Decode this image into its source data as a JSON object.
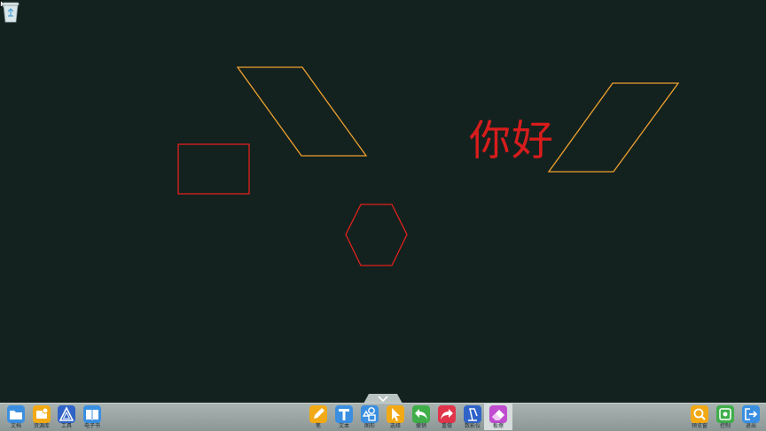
{
  "canvas": {
    "text": "你好",
    "text_color": "#d81c1c",
    "shape_colors": {
      "orange": "#f0a030",
      "red": "#e0201e"
    }
  },
  "toolbar": {
    "left": [
      {
        "id": "doc",
        "label": "文档",
        "icon": "folder-icon",
        "color": "#3a8fe0"
      },
      {
        "id": "resources",
        "label": "资源库",
        "icon": "resource-library-icon",
        "color": "#f2a916"
      },
      {
        "id": "tools",
        "label": "工具",
        "icon": "tools-triangle-icon",
        "color": "#2f63c8"
      },
      {
        "id": "ebook",
        "label": "电子书",
        "icon": "book-icon",
        "color": "#3a8fe0"
      }
    ],
    "center": [
      {
        "id": "pen",
        "label": "笔",
        "icon": "pen-icon",
        "color": "#f2a916"
      },
      {
        "id": "text",
        "label": "文本",
        "icon": "text-icon",
        "color": "#3a8fe0"
      },
      {
        "id": "shape",
        "label": "图形",
        "icon": "shapes-icon",
        "color": "#3a8fe0"
      },
      {
        "id": "select",
        "label": "选择",
        "icon": "select-cursor-icon",
        "color": "#f2a916"
      },
      {
        "id": "undo",
        "label": "撤销",
        "icon": "undo-icon",
        "color": "#3fae49"
      },
      {
        "id": "redo",
        "label": "重做",
        "icon": "redo-icon",
        "color": "#e0344a"
      },
      {
        "id": "camera",
        "label": "数影仪",
        "icon": "visualizer-icon",
        "color": "#2f63c8"
      },
      {
        "id": "eraser",
        "label": "板擦",
        "icon": "eraser-icon",
        "color": "#c04ccf"
      }
    ],
    "right": [
      {
        "id": "preview",
        "label": "预览窗",
        "icon": "preview-icon",
        "color": "#f2a916"
      },
      {
        "id": "control",
        "label": "控制",
        "icon": "control-icon",
        "color": "#3fae49"
      },
      {
        "id": "exit",
        "label": "退出",
        "icon": "exit-icon",
        "color": "#3a8fe0"
      }
    ],
    "active": "eraser"
  }
}
